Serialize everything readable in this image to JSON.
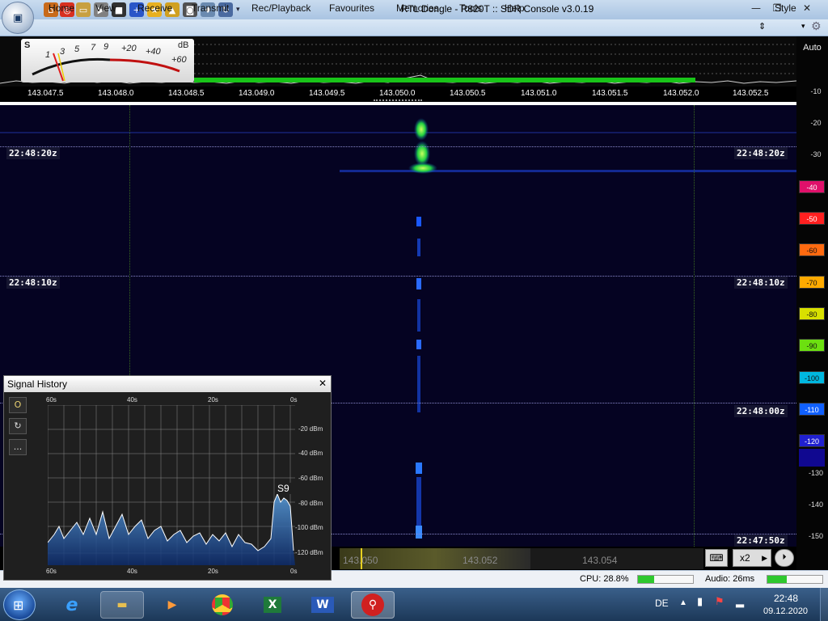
{
  "window": {
    "title": "RTL Dongle - R820T :: SDR Console v3.0.19"
  },
  "menu": [
    "Home",
    "View",
    "Receive",
    "Transmit",
    "Rec/Playback",
    "Favourites",
    "Memories",
    "Tools",
    "Help"
  ],
  "style_label": "Style",
  "meter": {
    "s_labels": [
      "S",
      "1",
      "3",
      "5",
      "7",
      "9",
      "+20",
      "+40",
      "+60"
    ],
    "unit": "dB"
  },
  "freq_scale": [
    "143.047.5",
    "143.048.0",
    "143.048.5",
    "143.049.0",
    "143.049.5",
    "143.050.0",
    "143.050.5",
    "143.051.0",
    "143.051.5",
    "143.052.0",
    "143.052.5"
  ],
  "time_markers": [
    "22:48:20z",
    "22:48:10z",
    "22:48:00z",
    "22:47:50z"
  ],
  "db_scale": {
    "auto_label": "Auto",
    "labels": [
      "-10",
      "-20",
      "-30",
      "-40",
      "-50",
      "-60",
      "-70",
      "-80",
      "-90",
      "-100",
      "-110",
      "-120",
      "-130",
      "-140",
      "-150"
    ],
    "colors": [
      "#e0106a",
      "#ff2020",
      "#ff6a10",
      "#ffaa00",
      "#d8e000",
      "#6ce010",
      "#10d040",
      "#00b8e0",
      "#1060ff",
      "#2020d0",
      "#100890"
    ]
  },
  "bottom_freq": [
    "143.050",
    "143.052",
    "143.054"
  ],
  "bottom_controls": {
    "zoom": "x2"
  },
  "status": {
    "cpu": "CPU: 28.8%",
    "cpu_level": 0.29,
    "audio": "Audio: 26ms",
    "audio_level": 0.35
  },
  "signal_history": {
    "title": "Signal History",
    "top_axis": [
      "60s",
      "40s",
      "20s",
      "0s"
    ],
    "bottom_axis": [
      "60s",
      "40s",
      "20s",
      "0s"
    ],
    "y_axis": [
      "-20 dBm",
      "-40 dBm",
      "-60 dBm",
      "-80 dBm",
      "-100 dBm",
      "-120 dBm"
    ],
    "s_label": "S9",
    "side_buttons": [
      "O",
      "↻",
      "..."
    ]
  },
  "taskbar": {
    "language": "DE",
    "time": "22:48",
    "date": "09.12.2020"
  }
}
